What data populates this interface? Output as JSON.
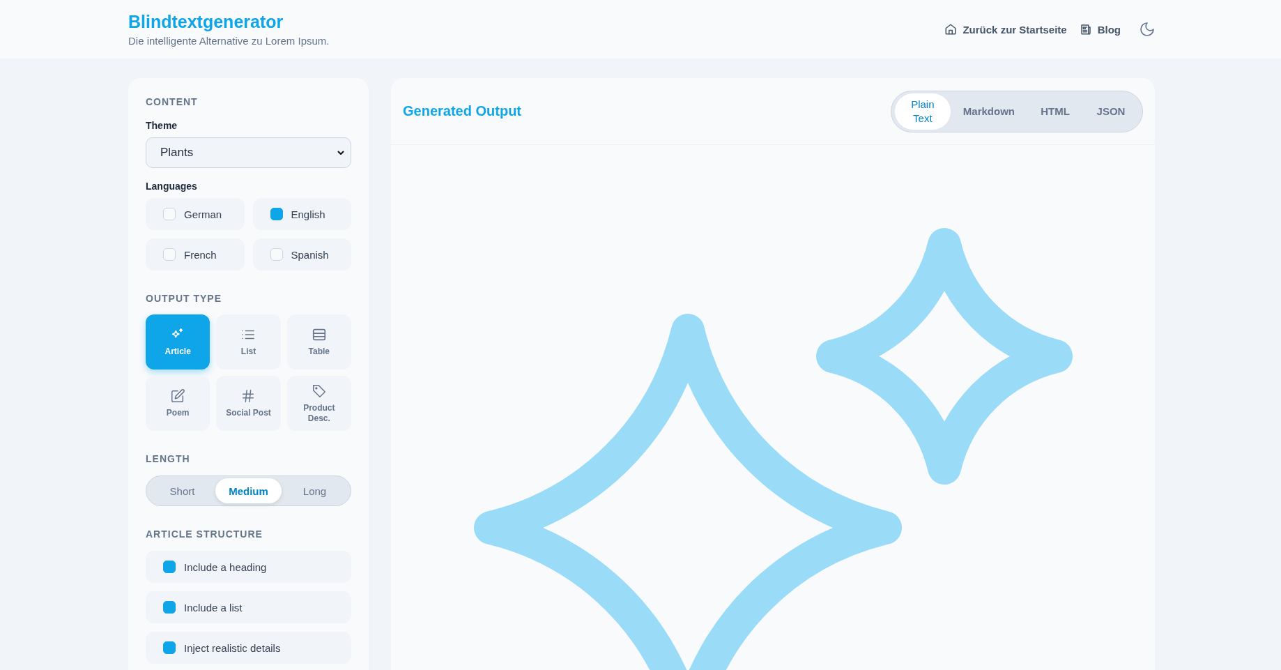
{
  "header": {
    "logo": "Blindtextgenerator",
    "tagline": "Die intelligente Alternative zu Lorem Ipsum.",
    "nav": [
      {
        "label": "Zurück zur Startseite",
        "kind": "home"
      },
      {
        "label": "Blog",
        "kind": "newspaper"
      }
    ]
  },
  "sidebar": {
    "content_heading": "CONTENT",
    "theme_label": "Theme",
    "theme_value": "Plants",
    "languages_label": "Languages",
    "languages": [
      {
        "label": "German",
        "checked": false
      },
      {
        "label": "English",
        "checked": true
      },
      {
        "label": "French",
        "checked": false
      },
      {
        "label": "Spanish",
        "checked": false
      }
    ],
    "output_type_heading": "OUTPUT TYPE",
    "output_types": [
      {
        "label": "Article",
        "kind": "sparkles",
        "selected": true
      },
      {
        "label": "List",
        "kind": "list",
        "selected": false
      },
      {
        "label": "Table",
        "kind": "table",
        "selected": false
      },
      {
        "label": "Poem",
        "kind": "pencil",
        "selected": false
      },
      {
        "label": "Social Post",
        "kind": "hash",
        "selected": false
      },
      {
        "label": "Product Desc.",
        "kind": "tag",
        "selected": false
      }
    ],
    "length_heading": "LENGTH",
    "lengths": [
      {
        "label": "Short",
        "selected": false
      },
      {
        "label": "Medium",
        "selected": true
      },
      {
        "label": "Long",
        "selected": false
      }
    ],
    "structure_heading": "ARTICLE STRUCTURE",
    "structure": [
      {
        "label": "Include a heading",
        "checked": true
      },
      {
        "label": "Include a list",
        "checked": true
      },
      {
        "label": "Inject realistic details",
        "checked": true
      }
    ]
  },
  "output": {
    "title": "Generated Output",
    "formats": [
      {
        "label": "Plain Text",
        "selected": true
      },
      {
        "label": "Markdown",
        "selected": false
      },
      {
        "label": "HTML",
        "selected": false
      },
      {
        "label": "JSON",
        "selected": false
      }
    ]
  }
}
